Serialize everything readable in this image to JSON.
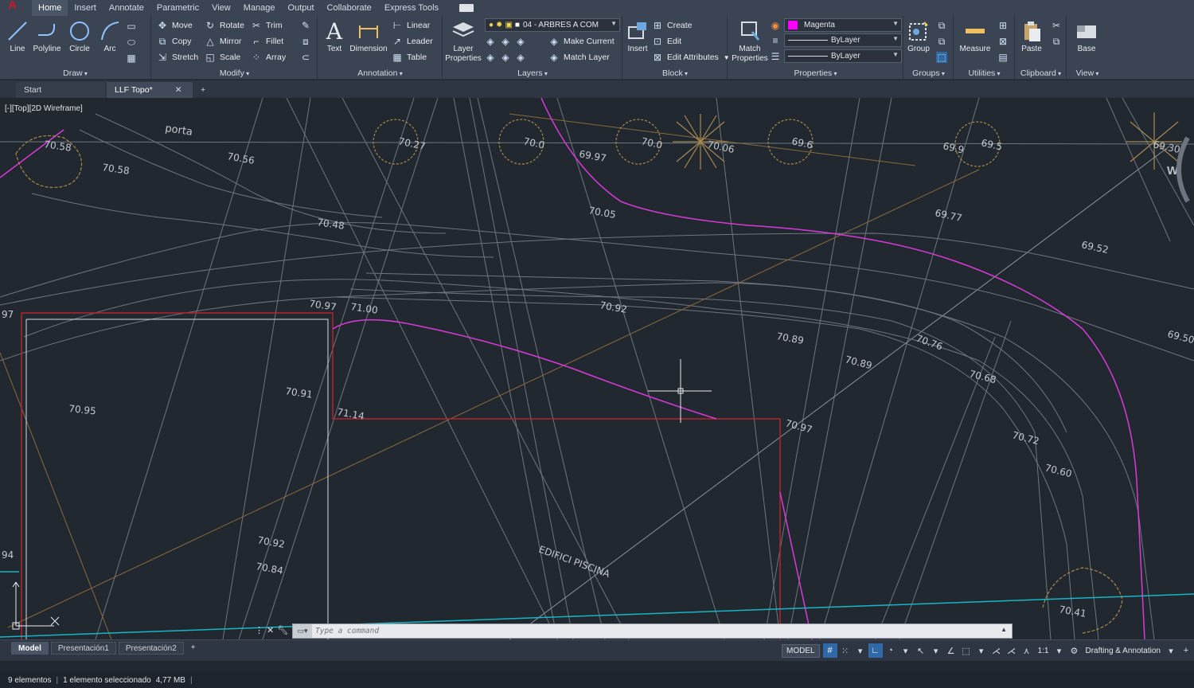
{
  "menu": {
    "tabs": [
      "Home",
      "Insert",
      "Annotate",
      "Parametric",
      "View",
      "Manage",
      "Output",
      "Collaborate",
      "Express Tools"
    ],
    "active": "Home"
  },
  "ribbon": {
    "draw": {
      "title": "Draw",
      "line": "Line",
      "polyline": "Polyline",
      "circle": "Circle",
      "arc": "Arc"
    },
    "modify": {
      "title": "Modify",
      "move": "Move",
      "rotate": "Rotate",
      "trim": "Trim",
      "copy": "Copy",
      "mirror": "Mirror",
      "fillet": "Fillet",
      "stretch": "Stretch",
      "scale": "Scale",
      "array": "Array"
    },
    "annotation": {
      "title": "Annotation",
      "text": "Text",
      "dimension": "Dimension",
      "linear": "Linear",
      "leader": "Leader",
      "table": "Table"
    },
    "layers": {
      "title": "Layers",
      "layer_properties": "Layer Properties",
      "current_layer": "04 - ARBRES A COM",
      "make_current": "Make Current",
      "match_layer": "Match Layer"
    },
    "block": {
      "title": "Block",
      "insert": "Insert",
      "create": "Create",
      "edit": "Edit",
      "edit_attributes": "Edit Attributes"
    },
    "properties": {
      "title": "Properties",
      "match_properties": "Match Properties",
      "color": "Magenta",
      "linetype": "ByLayer",
      "lineweight": "ByLayer"
    },
    "groups": {
      "title": "Groups",
      "group": "Group"
    },
    "utilities": {
      "title": "Utilities",
      "measure": "Measure"
    },
    "clipboard": {
      "title": "Clipboard",
      "paste": "Paste"
    },
    "view": {
      "title": "View",
      "base": "Base"
    }
  },
  "colors": {
    "magenta": "#d83ad8",
    "red": "#b2262c",
    "cyan": "#19b5c4",
    "brown": "#8a6a3d",
    "tree": "#a88a4e",
    "line": "#8b939c"
  },
  "doctabs": {
    "start": "Start",
    "active": "LLF Topo*"
  },
  "viewport": {
    "label": "[-][Top][2D Wireframe]",
    "compass": "W"
  },
  "drawing": {
    "elevations": [
      "70.58",
      "70.56",
      "70.58",
      "70.48",
      "70.97",
      "71.00",
      "70.92",
      "70.91",
      "70.95",
      "71.14",
      "70.97",
      "70.89",
      "70.89",
      "70.76",
      "70.68",
      "70.72",
      "70.60",
      "70.41",
      "70.92",
      "70.84",
      "69.97",
      "70.05",
      "69.77",
      "69.52",
      "69.50",
      "69.30",
      "70.27",
      "70.0",
      "70.0",
      "70.06",
      "69.6",
      "69.9",
      "69.5",
      "97",
      "94"
    ],
    "word_porta": "porta",
    "building_label": "EDIFICI PISCINA"
  },
  "command": {
    "placeholder": "Type a command"
  },
  "layouts": {
    "tabs": [
      "Model",
      "Presentación1",
      "Presentación2"
    ],
    "active": "Model"
  },
  "status": {
    "model": "MODEL",
    "scale": "1:1",
    "workspace": "Drafting & Annotation"
  },
  "bottom": {
    "elements": "9 elementos",
    "selected": "1 elemento seleccionado",
    "memory": "4,77 MB"
  }
}
